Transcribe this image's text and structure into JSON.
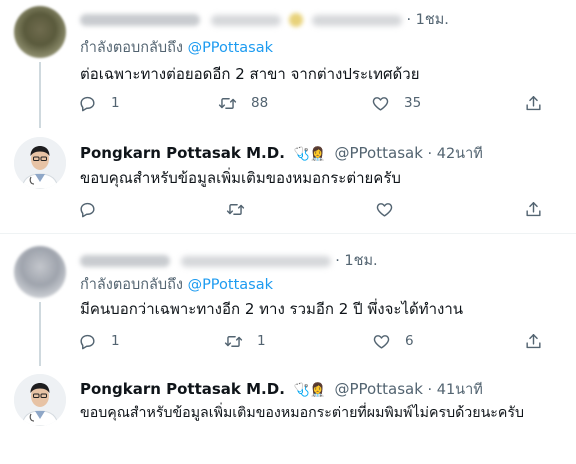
{
  "tweets": [
    {
      "time": "· 1ชม.",
      "replying_prefix": "กำลังตอบกลับถึง",
      "replying_to": "@PPottasak",
      "text": "ต่อเฉพาะทางต่อยอดอีก 2 สาขา จากต่างประเทศด้วย",
      "reply_count": "1",
      "retweet_count": "88",
      "like_count": "35"
    },
    {
      "name": "Pongkarn Pottasak M.D.",
      "badge": "🩺👩‍⚕️",
      "handle": "@PPottasak",
      "time": "· 42นาที",
      "text": "ขอบคุณสำหรับข้อมูลเพิ่มเติมของหมอกระต่ายครับ",
      "reply_count": "",
      "retweet_count": "",
      "like_count": ""
    },
    {
      "time": "· 1ชม.",
      "replying_prefix": "กำลังตอบกลับถึง",
      "replying_to": "@PPottasak",
      "text": "มีคนบอกว่าเฉพาะทางอีก 2 ทาง รวมอีก 2 ปี พึ่งจะได้ทำงาน",
      "reply_count": "1",
      "retweet_count": "1",
      "like_count": "6"
    },
    {
      "name": "Pongkarn Pottasak M.D.",
      "badge": "🩺👩‍⚕️",
      "handle": "@PPottasak",
      "time": "· 41นาที",
      "text": "ขอบคุณสำหรับข้อมูลเพิ่มเติมของหมอกระต่ายที่ผมพิมพ์ไม่ครบด้วยนะครับ",
      "reply_count": "",
      "retweet_count": "",
      "like_count": ""
    }
  ],
  "icons": {
    "reply": "reply-icon",
    "retweet": "retweet-icon",
    "like": "heart-icon",
    "share": "share-icon",
    "stethoscope": "stethoscope-icon"
  },
  "colors": {
    "link": "#1d9bf0",
    "secondary": "#536471",
    "text": "#0f1419",
    "line": "#cfd9de"
  }
}
